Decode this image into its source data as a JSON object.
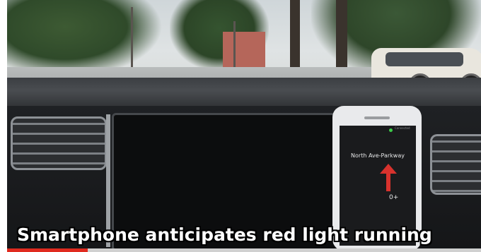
{
  "caption": {
    "text": "Smartphone anticipates red light running"
  },
  "phone": {
    "status_text": "Connected",
    "street_name": "North Ave-Parkway",
    "distance_text": "0+",
    "arrow_direction": "up",
    "arrow_color": "#d8322d"
  },
  "video_progress": {
    "fraction": 0.17,
    "fill_color": "#e02a1f"
  }
}
